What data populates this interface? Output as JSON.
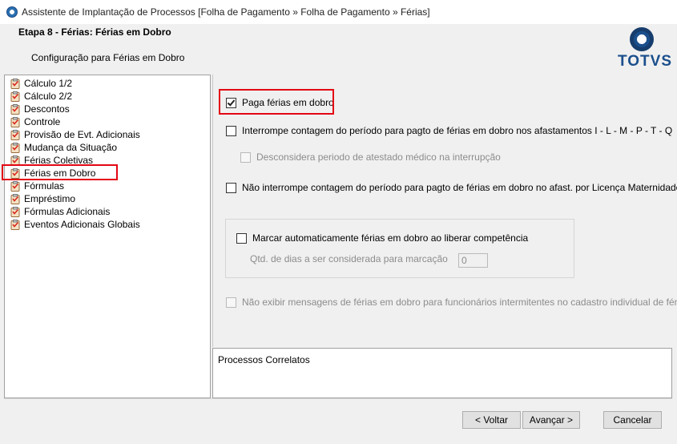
{
  "window": {
    "title": "Assistente de Implantação de Processos [Folha de Pagamento » Folha de Pagamento » Férias]"
  },
  "header": {
    "step_title": "Etapa 8 - Férias: Férias em Dobro",
    "step_subtitle": "Configuração para Férias em Dobro",
    "logo_text": "TOTVS"
  },
  "tree": {
    "items": [
      {
        "label": "Cálculo 1/2"
      },
      {
        "label": "Cálculo 2/2"
      },
      {
        "label": "Descontos"
      },
      {
        "label": "Controle"
      },
      {
        "label": "Provisão de Evt. Adicionais"
      },
      {
        "label": "Mudança da Situação"
      },
      {
        "label": "Férias Coletivas"
      },
      {
        "label": "Férias em Dobro",
        "selected": true
      },
      {
        "label": "Fórmulas"
      },
      {
        "label": "Empréstimo"
      },
      {
        "label": "Fórmulas Adicionais"
      },
      {
        "label": "Eventos Adicionais Globais"
      }
    ]
  },
  "options": {
    "paga_ferias": {
      "label": "Paga férias em dobro",
      "checked": true,
      "enabled": true
    },
    "interrompe": {
      "label": "Interrompe contagem do período para pagto de férias em dobro nos afastamentos I - L - M - P - T - Q",
      "checked": false,
      "enabled": true
    },
    "desconsidera": {
      "label": "Desconsidera periodo de atestado médico na interrupção",
      "checked": false,
      "enabled": false
    },
    "nao_interrompe": {
      "label": "Não interrompe contagem do período para pagto de férias em dobro no afast. por Licença Maternidade (E)",
      "checked": false,
      "enabled": true
    },
    "marcar_auto": {
      "label": "Marcar automaticamente férias em dobro ao liberar competência",
      "checked": false,
      "enabled": true
    },
    "qtd_dias": {
      "label": "Qtd. de dias a ser considerada para marcação",
      "value": "0",
      "enabled": false
    },
    "nao_exibir": {
      "label": "Não exibir mensagens de férias em dobro para funcionários intermitentes no cadastro individual de férias",
      "checked": false,
      "enabled": false
    }
  },
  "correlatos": {
    "label": "Processos Correlatos"
  },
  "buttons": {
    "back": "< Voltar",
    "next": "Avançar >",
    "cancel": "Cancelar"
  },
  "colors": {
    "highlight_red": "#e30613",
    "brand_blue": "#1b4f8c",
    "window_bg": "#f0f0f0"
  },
  "icons": {
    "app": "totvs-logo-icon",
    "tree_item": "clipboard-checklist-icon"
  }
}
